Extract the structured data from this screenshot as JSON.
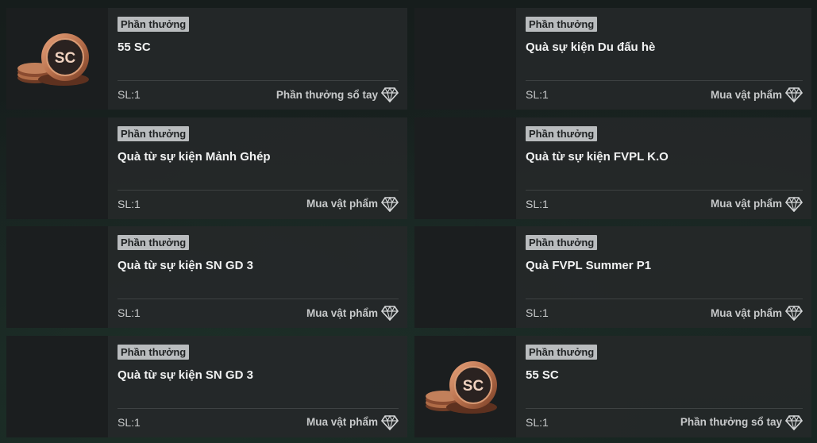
{
  "cards": [
    {
      "tag": "Phần thưởng",
      "title": "55 SC",
      "qty": "SL:1",
      "action": "Phần thưởng sổ tay",
      "thumb": "sc-coin-icon"
    },
    {
      "tag": "Phần thưởng",
      "title": "Quà sự kiện Du đấu hè",
      "qty": "SL:1",
      "action": "Mua vật phẩm",
      "thumb": "none"
    },
    {
      "tag": "Phần thưởng",
      "title": "Quà từ sự kiện Mảnh Ghép",
      "qty": "SL:1",
      "action": "Mua vật phẩm",
      "thumb": "none"
    },
    {
      "tag": "Phần thưởng",
      "title": "Quà từ sự kiện FVPL K.O",
      "qty": "SL:1",
      "action": "Mua vật phẩm",
      "thumb": "none"
    },
    {
      "tag": "Phần thưởng",
      "title": "Quà từ sự kiện SN GD 3",
      "qty": "SL:1",
      "action": "Mua vật phẩm",
      "thumb": "none"
    },
    {
      "tag": "Phần thưởng",
      "title": "Quà FVPL Summer P1",
      "qty": "SL:1",
      "action": "Mua vật phẩm",
      "thumb": "none"
    },
    {
      "tag": "Phần thưởng",
      "title": "Quà từ sự kiện SN GD 3",
      "qty": "SL:1",
      "action": "Mua vật phẩm",
      "thumb": "none"
    },
    {
      "tag": "Phần thưởng",
      "title": "55 SC",
      "qty": "SL:1",
      "action": "Phần thưởng sổ tay",
      "thumb": "sc-coin-icon"
    }
  ],
  "coin_label": "SC",
  "colors": {
    "card_bg": "#252829",
    "tag_bg": "#b9bcbe",
    "title": "#f1f2f2",
    "muted": "#c7c9ca",
    "coin": "#c07a55"
  }
}
